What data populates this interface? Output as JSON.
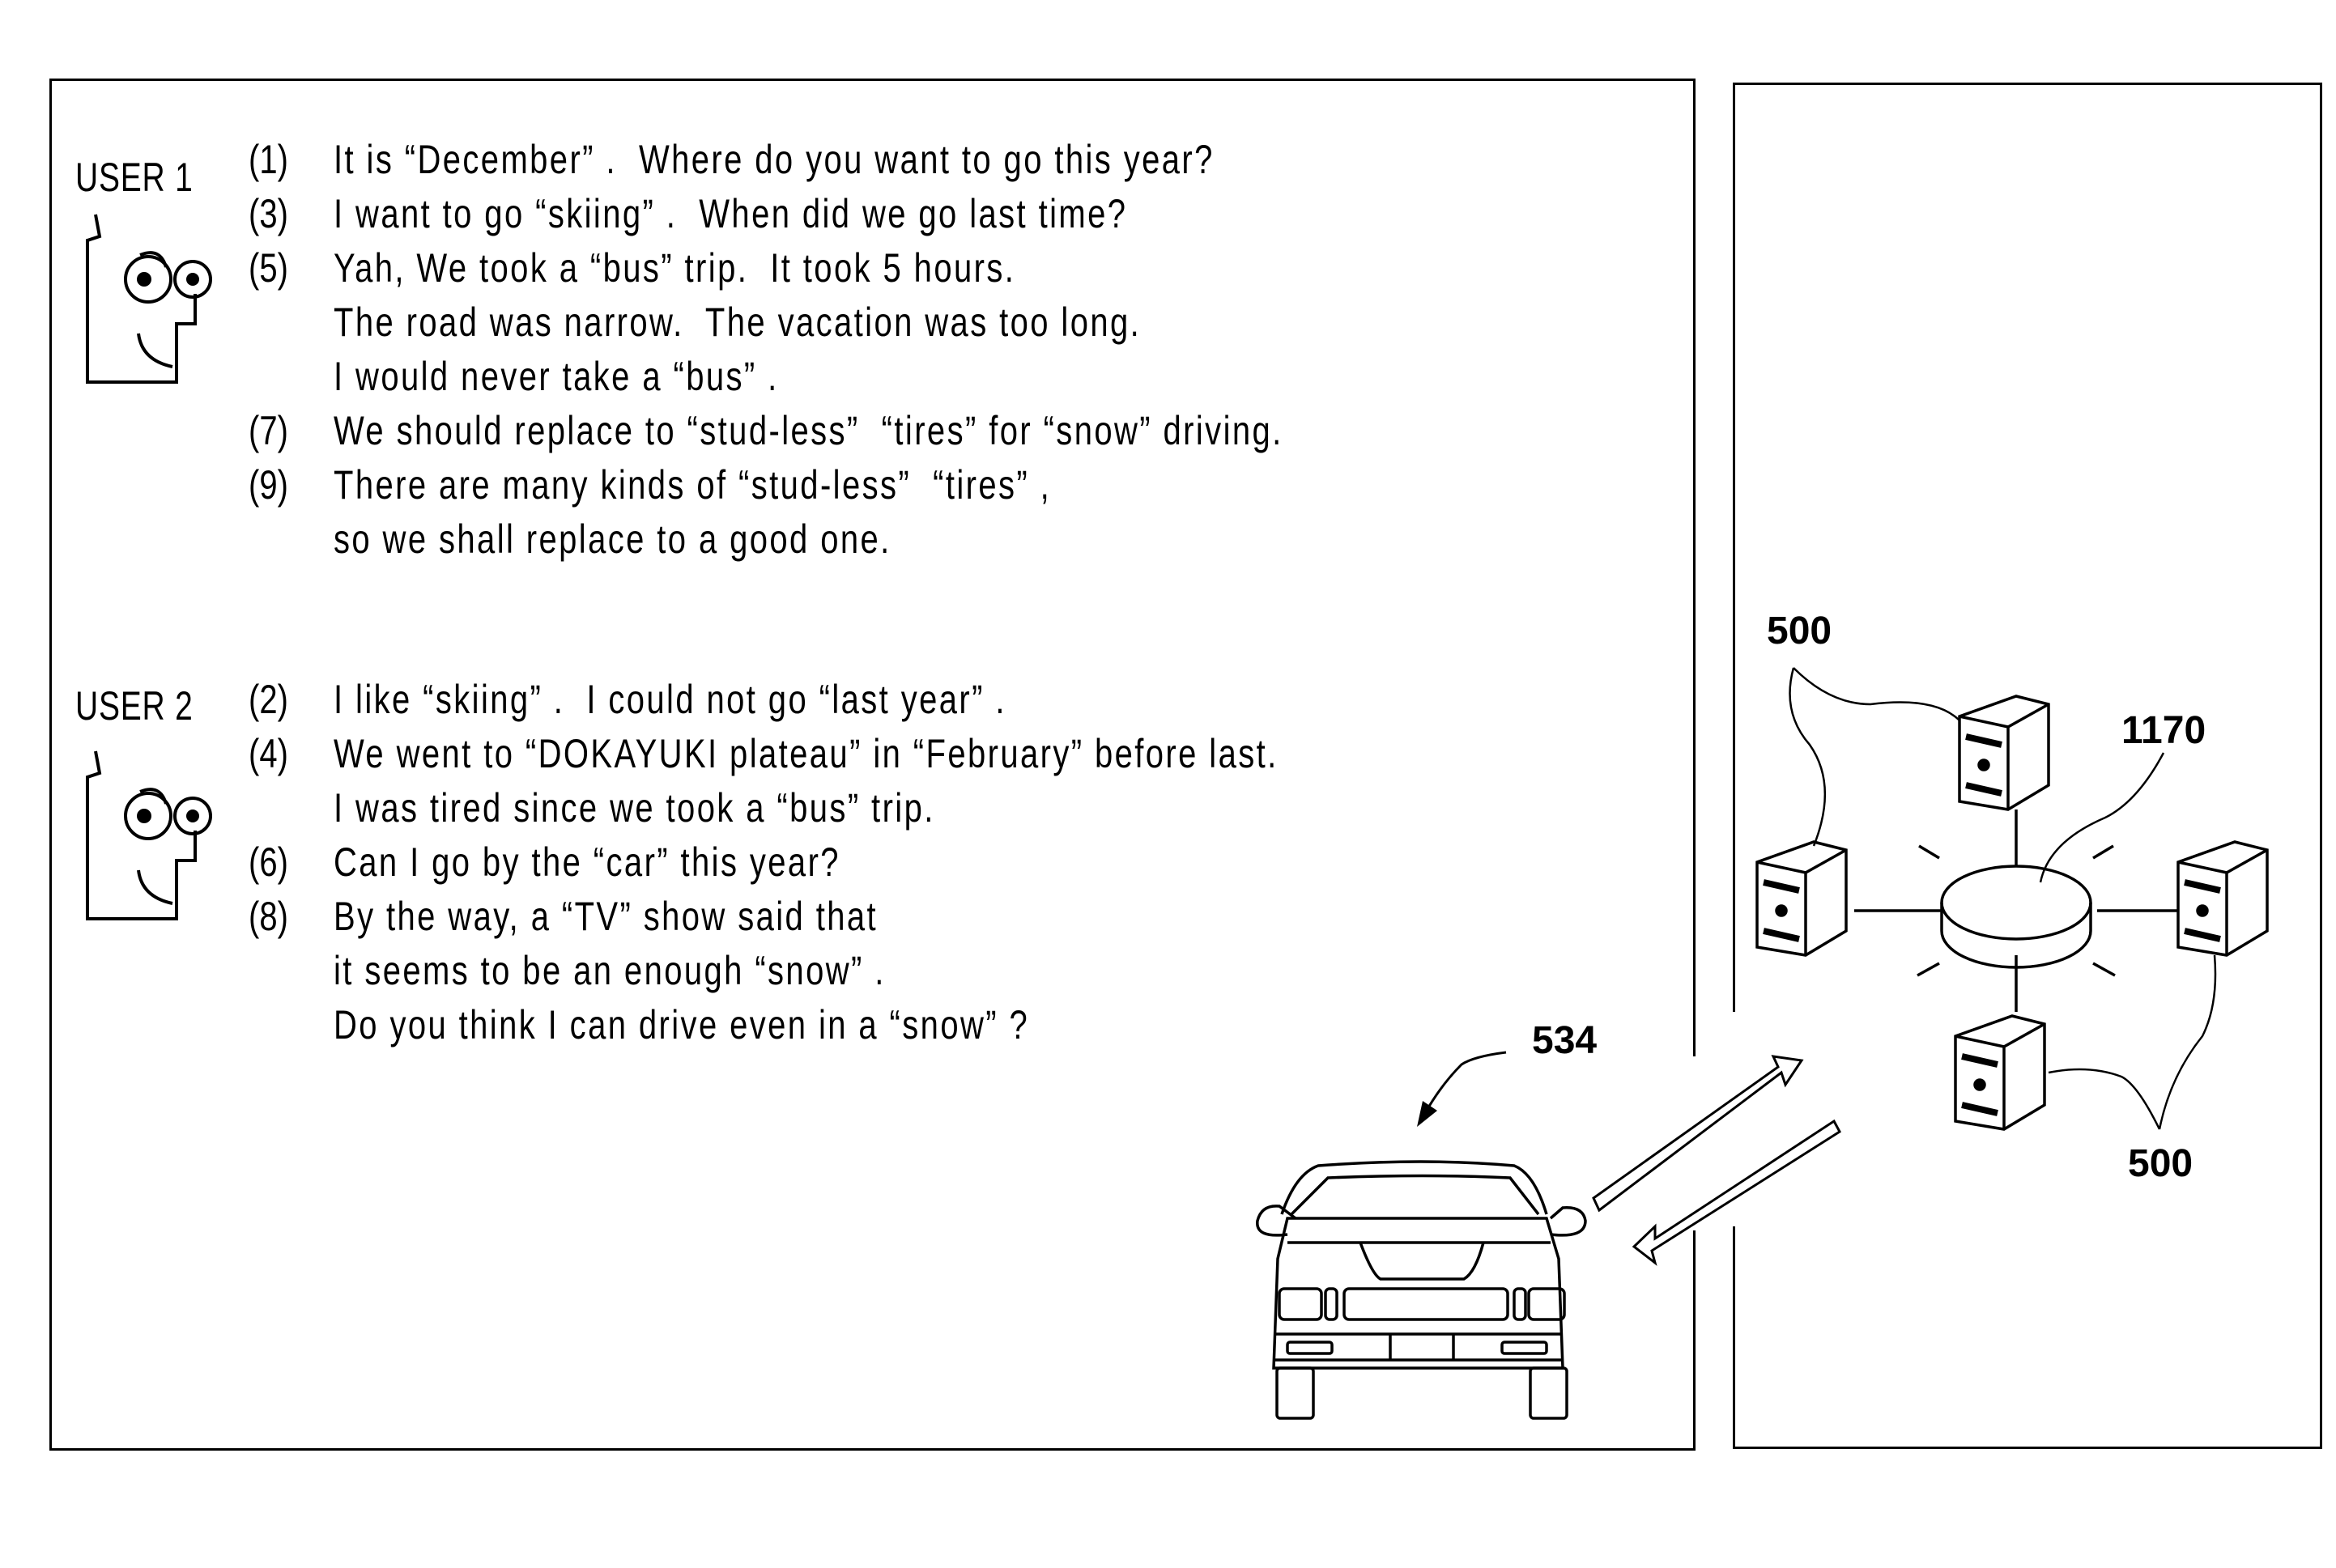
{
  "users": [
    {
      "label": "USER 1",
      "utterances": [
        {
          "num": "(1)",
          "lines": [
            "It is “December” .  Where do you want to go this year?"
          ]
        },
        {
          "num": "(3)",
          "lines": [
            "I want to go “skiing” .  When did we go last time?"
          ]
        },
        {
          "num": "(5)",
          "lines": [
            "Yah, We took a “bus” trip.  It took 5 hours.",
            "The road was narrow.  The vacation was too long.",
            "I would never take a “bus” ."
          ]
        },
        {
          "num": "(7)",
          "lines": [
            "We should replace to “stud-less”  “tires” for “snow” driving."
          ]
        },
        {
          "num": "(9)",
          "lines": [
            "There are many kinds of “stud-less”  “tires” ,",
            "so we shall replace to a good one."
          ]
        }
      ]
    },
    {
      "label": "USER 2",
      "utterances": [
        {
          "num": "(2)",
          "lines": [
            "I like “skiing” .  I could not go “last year” ."
          ]
        },
        {
          "num": "(4)",
          "lines": [
            "We went to “DOKAYUKI plateau” in “February” before last.",
            "I was tired since we took a “bus” trip."
          ]
        },
        {
          "num": "(6)",
          "lines": [
            "Can I go by the “car” this year?"
          ]
        },
        {
          "num": "(8)",
          "lines": [
            "By the way, a “TV” show said that",
            "it seems to be an enough “snow” .",
            "Do you think I can drive even in a “snow” ?"
          ]
        }
      ]
    }
  ],
  "references": {
    "vehicle": "534",
    "network": "1170",
    "server_top": "500",
    "server_bottom": "500"
  },
  "icons": {
    "user_face": "face-icon",
    "vehicle": "car-icon",
    "server": "server-icon",
    "network_hub": "network-hub-icon",
    "uplink": "arrow-up-right-icon",
    "downlink": "arrow-down-left-icon"
  }
}
